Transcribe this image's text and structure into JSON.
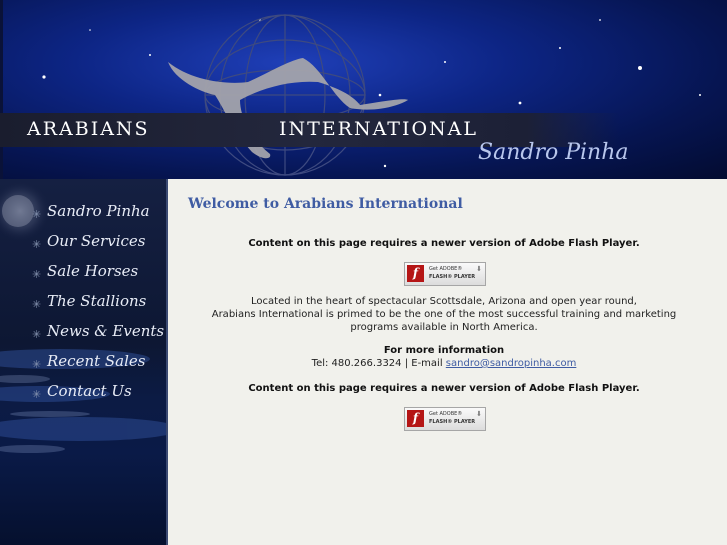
{
  "header": {
    "logo_left": "ARABIANS",
    "logo_right": "INTERNATIONAL",
    "signature": "Sandro Pinha"
  },
  "nav": {
    "items": [
      {
        "label": "Sandro Pinha"
      },
      {
        "label": "Our Services"
      },
      {
        "label": "Sale Horses"
      },
      {
        "label": "The Stallions"
      },
      {
        "label": "News & Events"
      },
      {
        "label": "Recent Sales"
      },
      {
        "label": "Contact Us"
      }
    ]
  },
  "main": {
    "title": "Welcome to Arabians International",
    "flash_notice": "Content on this page requires a newer version of Adobe Flash Player.",
    "flash_badge": {
      "line1": "Get ADOBE®",
      "line2": "FLASH® PLAYER",
      "icon": "f"
    },
    "intro_line1": "Located in the heart of spectacular Scottsdale, Arizona and open year round,",
    "intro_line2": "Arabians International is primed to be the one of the most successful training and marketing",
    "intro_line3": "programs available in North America.",
    "more_info_heading": "For more information",
    "contact_prefix": "Tel: 480.266.3324 | E-mail ",
    "email": "sandro@sandropinha.com"
  },
  "colors": {
    "header_bg": "#0d2585",
    "sidebar_bg": "#0d1733",
    "main_bg": "#f1f1ec",
    "title": "#3f5ca3",
    "link": "#3f5ca3",
    "flash_red": "#b51515"
  }
}
